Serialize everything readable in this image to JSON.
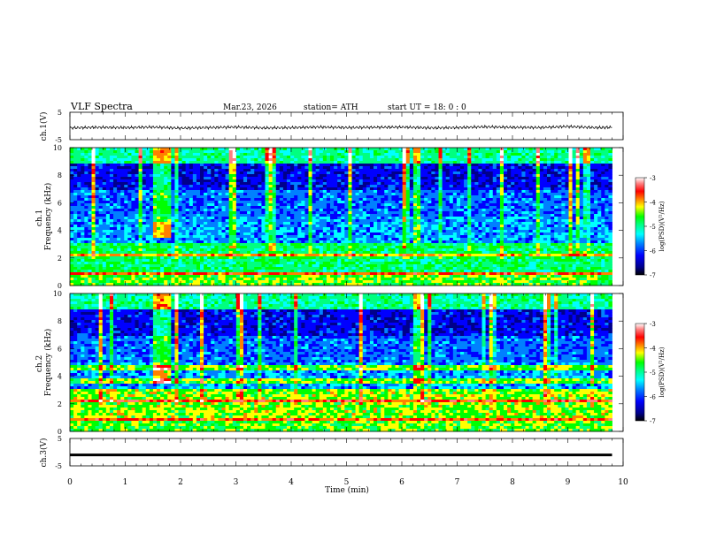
{
  "header": {
    "title": "VLF  Spectra",
    "date": "Mar.23, 2026",
    "station": "station= ATH",
    "start_time": "start  UT  =   18: 0   : 0"
  },
  "colors": {
    "background": "#ffffff",
    "axis": "#000000",
    "colormap": [
      "#000000",
      "#00008b",
      "#0000ff",
      "#0080ff",
      "#00ffff",
      "#00ff80",
      "#00ff00",
      "#ffff00",
      "#ff8000",
      "#ff0000",
      "#ff8080",
      "#ffffff"
    ]
  },
  "chart_data": [
    {
      "type": "line",
      "id": "ch1",
      "ylabel": "ch.1(V)",
      "ylim": [
        -5,
        5
      ],
      "yticks": [
        "5",
        "-5"
      ],
      "xlim": [
        0,
        10
      ],
      "series": [
        {
          "x": [
            0,
            0.5,
            1,
            1.5,
            2,
            2.5,
            3,
            3.5,
            4,
            4.5,
            5,
            5.5,
            6,
            6.5,
            7,
            7.5,
            8,
            8.5,
            9,
            9.5,
            9.8
          ],
          "values": [
            -0.7,
            -0.5,
            -0.6,
            -0.4,
            -0.8,
            -0.6,
            -0.4,
            -0.7,
            -0.6,
            -0.4,
            -0.6,
            -0.5,
            -0.4,
            -0.7,
            -0.6,
            -0.3,
            -0.5,
            -0.6,
            -0.2,
            -0.6,
            -0.5
          ]
        }
      ]
    },
    {
      "type": "heatmap",
      "id": "ch1_spectrogram",
      "ylabel": "ch.1\nFrequency (kHz)",
      "ylim": [
        0,
        10
      ],
      "yticks": [
        "10",
        "8",
        "6",
        "4",
        "2",
        "0"
      ],
      "xlim": [
        0,
        9.8
      ],
      "colorbar": {
        "label": "log(PSD)(V²/Hz)",
        "range": [
          -7,
          -3
        ],
        "ticks": [
          "-3",
          "-4",
          "-5",
          "-6",
          "-7"
        ]
      }
    },
    {
      "type": "heatmap",
      "id": "ch2_spectrogram",
      "ylabel": "ch.2\nFrequency (kHz)",
      "ylim": [
        0,
        10
      ],
      "yticks": [
        "10",
        "8",
        "6",
        "4",
        "2",
        "0"
      ],
      "xlim": [
        0,
        9.8
      ],
      "colorbar": {
        "label": "log(PSD)(V²/Hz)",
        "range": [
          -7,
          -3
        ],
        "ticks": [
          "-3",
          "-4",
          "-5",
          "-6",
          "-7"
        ]
      }
    },
    {
      "type": "line",
      "id": "ch3",
      "ylabel": "ch.3(V)",
      "ylim": [
        -5,
        5
      ],
      "yticks": [
        "5",
        "-5"
      ],
      "xlim": [
        0,
        10
      ],
      "xlabel": "Time  (min)",
      "xticks": [
        "0",
        "1",
        "2",
        "3",
        "4",
        "5",
        "6",
        "7",
        "8",
        "9",
        "10"
      ],
      "series": [
        {
          "x": [
            0,
            9.8
          ],
          "values": [
            -1.0,
            -1.0
          ]
        }
      ]
    }
  ]
}
